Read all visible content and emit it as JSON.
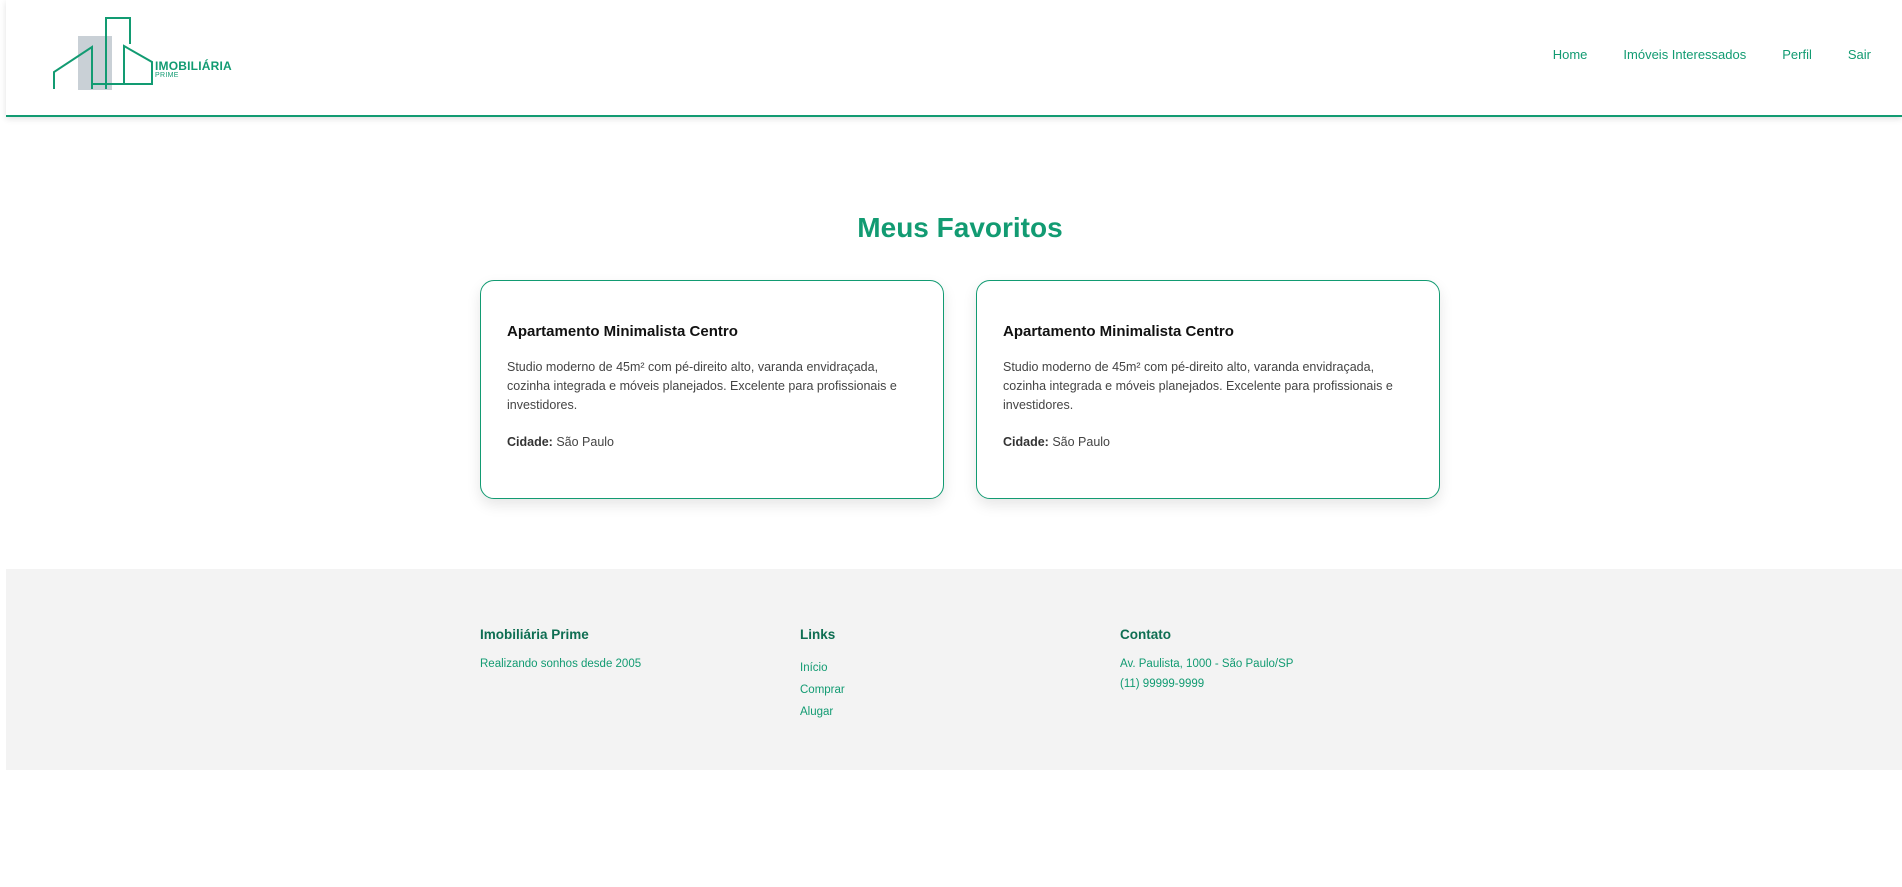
{
  "brand": {
    "name": "IMOBILIÁRIA",
    "sub": "PRIME"
  },
  "nav": {
    "home": "Home",
    "interested": "Imóveis Interessados",
    "profile": "Perfil",
    "logout": "Sair"
  },
  "page_title": "Meus Favoritos",
  "favorites": [
    {
      "title": "Apartamento Minimalista Centro",
      "description": "Studio moderno de 45m² com pé-direito alto, varanda envidraçada, cozinha integrada e móveis planejados. Excelente para profissionais e investidores.",
      "city_label": "Cidade:",
      "city": "São Paulo"
    },
    {
      "title": "Apartamento Minimalista Centro",
      "description": "Studio moderno de 45m² com pé-direito alto, varanda envidraçada, cozinha integrada e móveis planejados. Excelente para profissionais e investidores.",
      "city_label": "Cidade:",
      "city": "São Paulo"
    }
  ],
  "footer": {
    "about": {
      "title": "Imobiliária Prime",
      "tagline": "Realizando sonhos desde 2005"
    },
    "links": {
      "title": "Links",
      "items": [
        "Início",
        "Comprar",
        "Alugar"
      ]
    },
    "contact": {
      "title": "Contato",
      "address": "Av. Paulista, 1000 - São Paulo/SP",
      "phone": "(11) 99999-9999"
    }
  },
  "colors": {
    "accent": "#129b72",
    "footer_bg": "#f3f3f3",
    "footer_heading": "#0e6e52"
  }
}
